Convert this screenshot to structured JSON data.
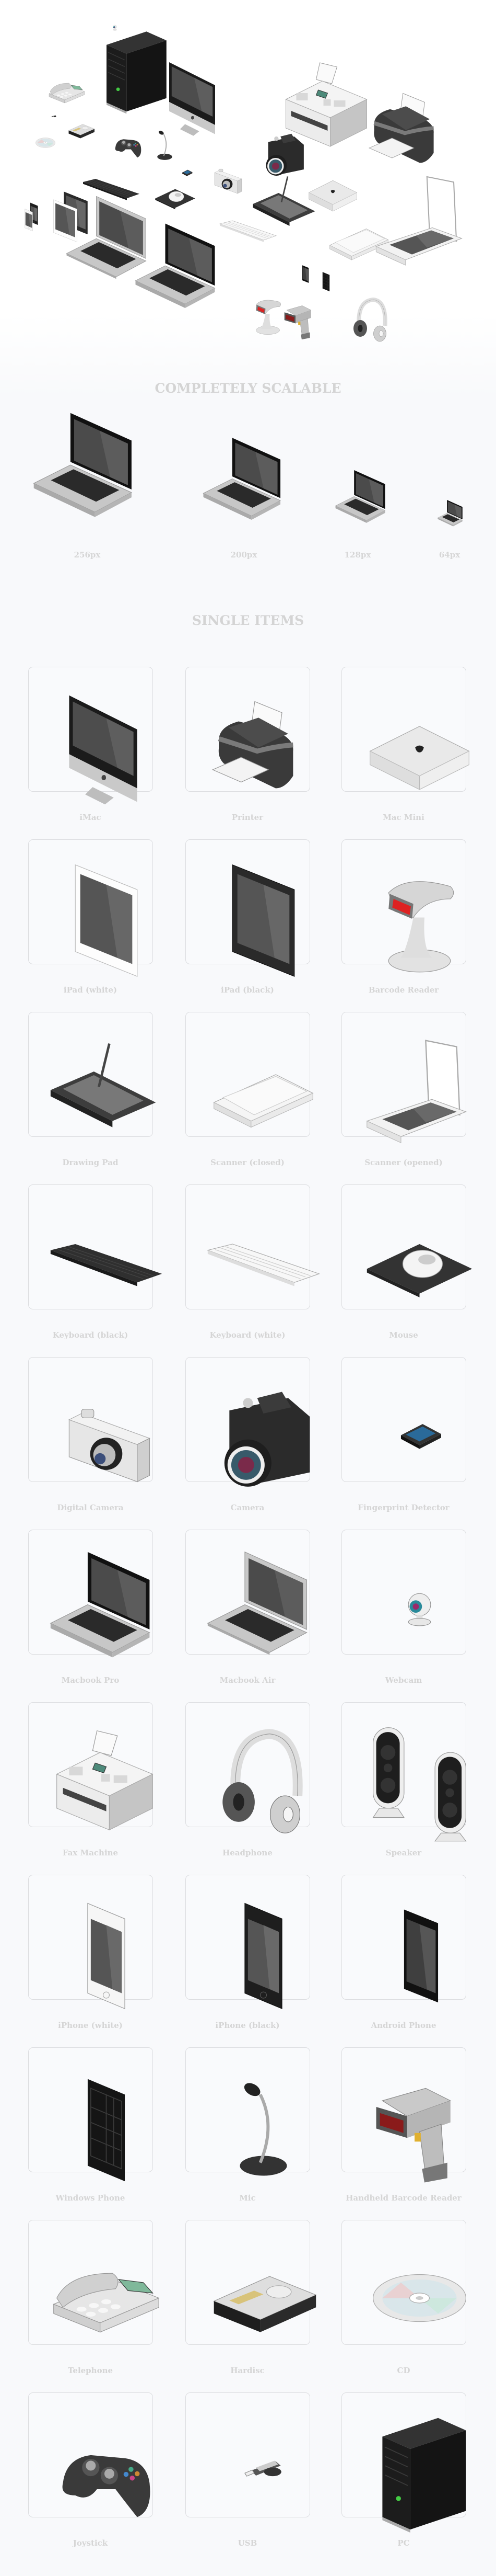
{
  "hero": {
    "items": [
      {
        "icon": "pc",
        "name": "hero-pc"
      },
      {
        "icon": "webcam",
        "name": "hero-webcam"
      },
      {
        "icon": "imac",
        "name": "hero-imac"
      },
      {
        "icon": "telephone",
        "name": "hero-telephone"
      },
      {
        "icon": "usb",
        "name": "hero-usb"
      },
      {
        "icon": "hardisc",
        "name": "hero-hardisc"
      },
      {
        "icon": "cd",
        "name": "hero-cd"
      },
      {
        "icon": "joystick",
        "name": "hero-joystick"
      },
      {
        "icon": "mic",
        "name": "hero-mic"
      },
      {
        "icon": "speaker-single",
        "name": "hero-speaker"
      },
      {
        "icon": "fax",
        "name": "hero-fax"
      },
      {
        "icon": "printer",
        "name": "hero-printer"
      },
      {
        "icon": "keyboard-black",
        "name": "hero-keyboard-black"
      },
      {
        "icon": "fingerprint",
        "name": "hero-fingerprint"
      },
      {
        "icon": "digital-camera",
        "name": "hero-digital-camera"
      },
      {
        "icon": "camera",
        "name": "hero-camera"
      },
      {
        "icon": "mouse",
        "name": "hero-mouse"
      },
      {
        "icon": "drawing-pad",
        "name": "hero-drawing-pad"
      },
      {
        "icon": "mac-mini",
        "name": "hero-mac-mini"
      },
      {
        "icon": "keyboard-white",
        "name": "hero-keyboard-white"
      },
      {
        "icon": "scanner-closed",
        "name": "hero-scanner-closed"
      },
      {
        "icon": "scanner-opened",
        "name": "hero-scanner-opened"
      },
      {
        "icon": "iphone-black",
        "name": "hero-iphone-black"
      },
      {
        "icon": "iphone-white",
        "name": "hero-iphone-white"
      },
      {
        "icon": "ipad-black",
        "name": "hero-ipad-black"
      },
      {
        "icon": "ipad-white",
        "name": "hero-ipad-white"
      },
      {
        "icon": "macbook-air",
        "name": "hero-macbook-air"
      },
      {
        "icon": "macbook-pro",
        "name": "hero-macbook-pro"
      },
      {
        "icon": "android",
        "name": "hero-android"
      },
      {
        "icon": "windows-phone",
        "name": "hero-windows-phone"
      },
      {
        "icon": "barcode",
        "name": "hero-barcode-reader"
      },
      {
        "icon": "handheld-barcode",
        "name": "hero-handheld-barcode"
      },
      {
        "icon": "headphone",
        "name": "hero-headphone"
      }
    ]
  },
  "scalable": {
    "title": "COMPLETELY SCALABLE",
    "sizes": [
      {
        "label": "256px",
        "icon": "macbook-pro"
      },
      {
        "label": "200px",
        "icon": "macbook-pro"
      },
      {
        "label": "128px",
        "icon": "macbook-pro"
      },
      {
        "label": "64px",
        "icon": "macbook-pro"
      }
    ]
  },
  "single_items": {
    "title": "SINGLE ITEMS",
    "items": [
      {
        "label": "iMac",
        "icon": "imac"
      },
      {
        "label": "Printer",
        "icon": "printer"
      },
      {
        "label": "Mac Mini",
        "icon": "mac-mini"
      },
      {
        "label": "iPad (white)",
        "icon": "ipad-white"
      },
      {
        "label": "iPad (black)",
        "icon": "ipad-black"
      },
      {
        "label": "Barcode Reader",
        "icon": "barcode"
      },
      {
        "label": "Drawing Pad",
        "icon": "drawing-pad"
      },
      {
        "label": "Scanner (closed)",
        "icon": "scanner-closed"
      },
      {
        "label": "Scanner (opened)",
        "icon": "scanner-opened"
      },
      {
        "label": "Keyboard (black)",
        "icon": "keyboard-black"
      },
      {
        "label": "Keyboard (white)",
        "icon": "keyboard-white"
      },
      {
        "label": "Mouse",
        "icon": "mouse"
      },
      {
        "label": "Digital Camera",
        "icon": "digital-camera"
      },
      {
        "label": "Camera",
        "icon": "camera"
      },
      {
        "label": "Fingerprint Detector",
        "icon": "fingerprint"
      },
      {
        "label": "Macbook Pro",
        "icon": "macbook-pro"
      },
      {
        "label": "Macbook Air",
        "icon": "macbook-air"
      },
      {
        "label": "Webcam",
        "icon": "webcam"
      },
      {
        "label": "Fax Machine",
        "icon": "fax"
      },
      {
        "label": "Headphone",
        "icon": "headphone"
      },
      {
        "label": "Speaker",
        "icon": "speaker"
      },
      {
        "label": "iPhone (white)",
        "icon": "iphone-white"
      },
      {
        "label": "iPhone (black)",
        "icon": "iphone-black"
      },
      {
        "label": "Android Phone",
        "icon": "android"
      },
      {
        "label": "Windows Phone",
        "icon": "windows-phone"
      },
      {
        "label": "Mic",
        "icon": "mic"
      },
      {
        "label": "Handheld Barcode Reader",
        "icon": "handheld-barcode"
      },
      {
        "label": "Telephone",
        "icon": "telephone"
      },
      {
        "label": "Hardisc",
        "icon": "hardisc"
      },
      {
        "label": "CD",
        "icon": "cd"
      },
      {
        "label": "Joystick",
        "icon": "joystick"
      },
      {
        "label": "USB",
        "icon": "usb"
      },
      {
        "label": "PC",
        "icon": "pc"
      }
    ]
  },
  "colors": {
    "heading": "#d4d4d4",
    "label": "#d5d5d5",
    "card_border": "#dcdde0",
    "card_bg": "#f9fafc",
    "page_bg": "#f8f9fb"
  }
}
